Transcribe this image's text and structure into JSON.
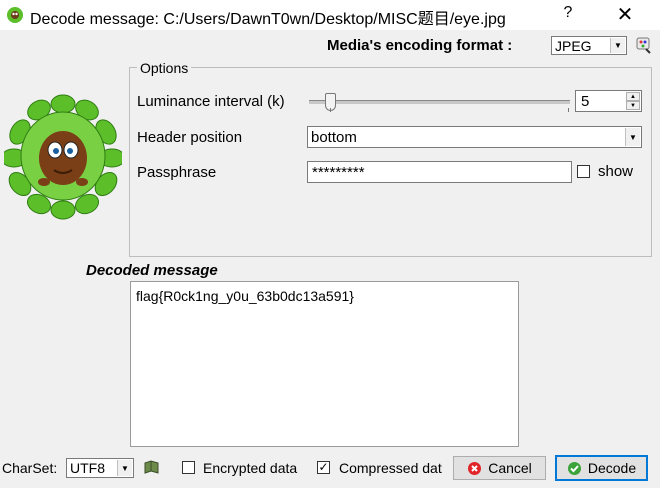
{
  "window": {
    "title": "Decode message: C:/Users/DawnT0wn/Desktop/MISC题目/eye.jpg",
    "help_label": "?",
    "close_label": "✕"
  },
  "encoding": {
    "label": "Media's encoding format :",
    "value": "JPEG"
  },
  "options": {
    "group_title": "Options",
    "luminance_label": "Luminance interval (k)",
    "luminance_value": "5",
    "luminance_slider_fraction": 0.05,
    "header_label": "Header position",
    "header_value": "bottom",
    "passphrase_label": "Passphrase",
    "passphrase_value": "*********",
    "show_label": "show",
    "show_checked": false
  },
  "decoded": {
    "label": "Decoded message",
    "text": "flag{R0ck1ng_y0u_63b0dc13a591}"
  },
  "bottom": {
    "charset_label": "CharSet:",
    "charset_value": "UTF8",
    "encrypted_label": "Encrypted data",
    "encrypted_checked": false,
    "compressed_label": "Compressed dat",
    "compressed_checked": true,
    "cancel_label": "Cancel",
    "decode_label": "Decode"
  },
  "icons": {
    "app": "leaf-character-icon",
    "mascot": "leafy-mascot-image",
    "palette": "palette-icon",
    "book": "book-icon",
    "cancel": "cancel-icon",
    "decode": "check-icon"
  },
  "colors": {
    "cancel_icon": "#e0242a",
    "decode_icon": "#3aa33a",
    "leaf": "#5cbf2a",
    "default_button_border": "#0078d7"
  }
}
